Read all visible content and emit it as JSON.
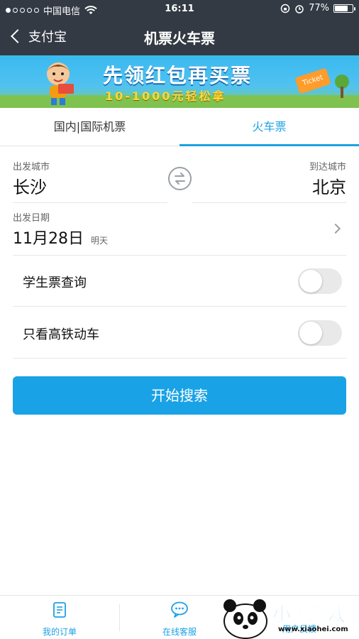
{
  "status": {
    "carrier": "中国电信",
    "time": "16:11",
    "battery_percent": "77%",
    "battery_level": 0.77
  },
  "nav": {
    "back_label": "支付宝",
    "title": "机票火车票"
  },
  "banner": {
    "headline": "先领红包再买票",
    "subline": "10-1000元轻松拿",
    "ticket_text": "Ticket"
  },
  "tabs": {
    "left": "国内|国际机票",
    "right": "火车票"
  },
  "form": {
    "from_label": "出发城市",
    "from_city": "长沙",
    "to_label": "到达城市",
    "to_city": "北京",
    "date_label": "出发日期",
    "date_value": "11月28日",
    "date_day": "明天",
    "student_label": "学生票查询",
    "student_enabled": false,
    "highspeed_label": "只看高铁动车",
    "highspeed_enabled": false,
    "search_button": "开始搜索"
  },
  "bottom": {
    "orders": "我的订单",
    "service": "在线客服",
    "feedback": "用户反馈"
  },
  "watermark": {
    "text": "小黑游戏",
    "url": "www.xiaohei.com"
  },
  "colors": {
    "accent": "#1aa2e6",
    "navbar": "#333a44"
  }
}
